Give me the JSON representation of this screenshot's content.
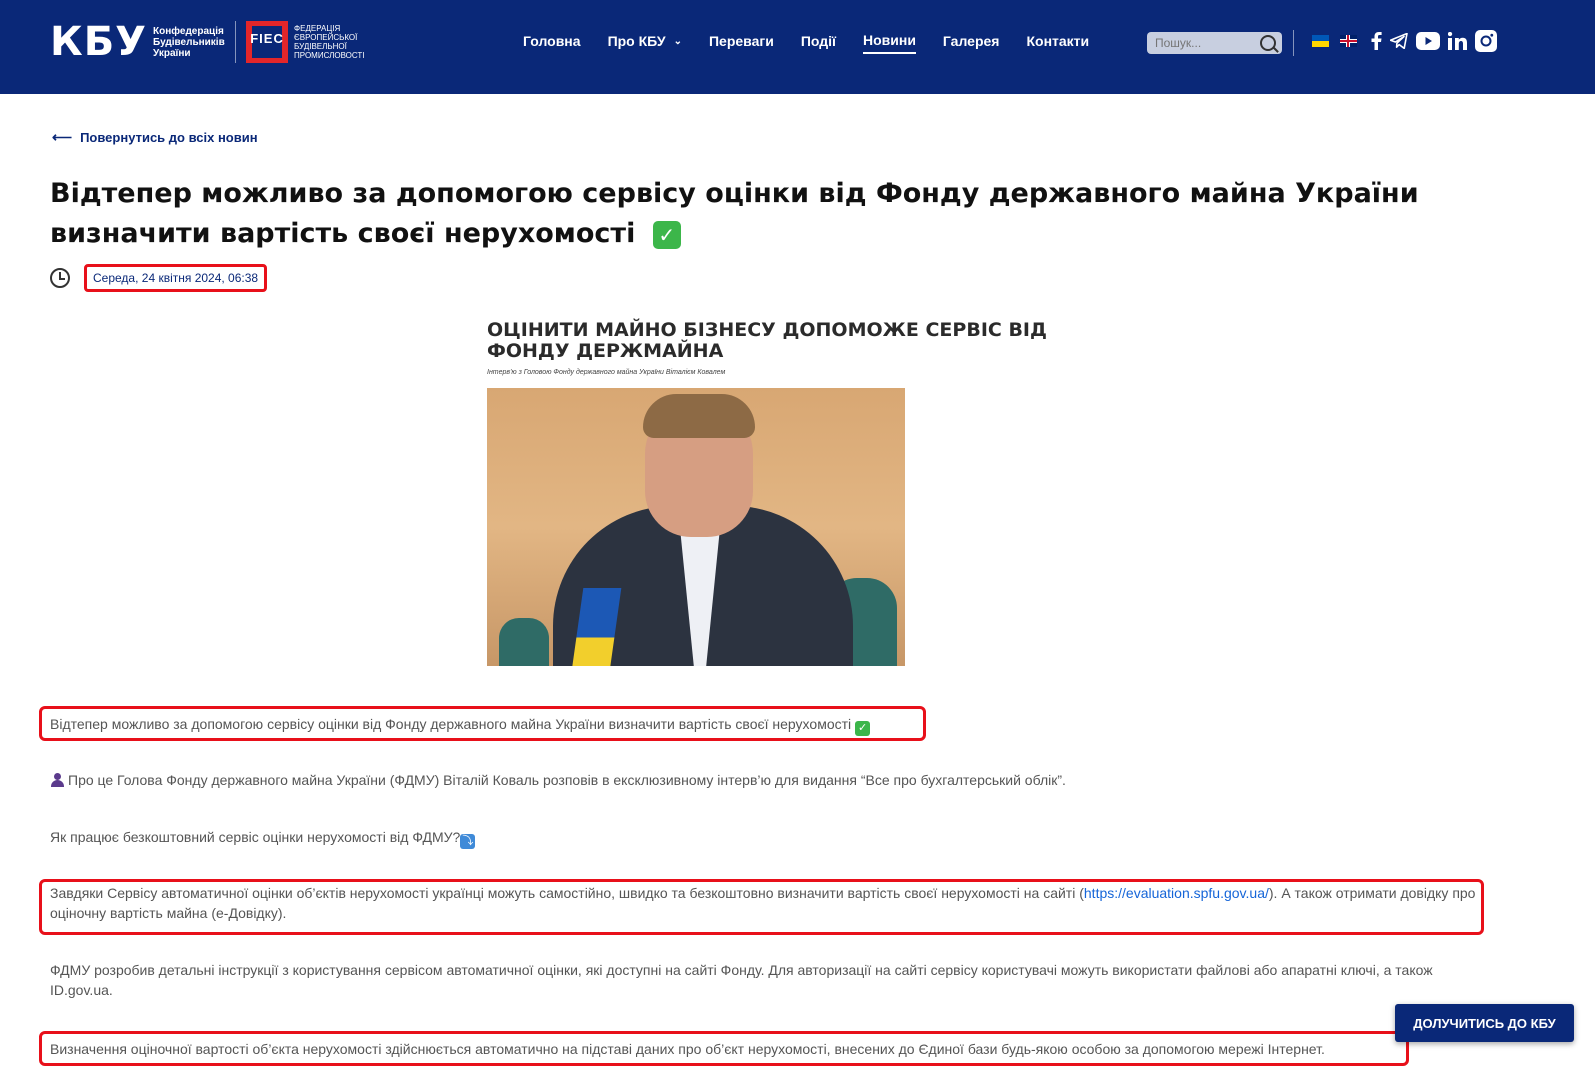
{
  "header": {
    "logo_text": "КБУ",
    "logo_sub": "Конфедерація Будівельників України",
    "fiec_text": "FIEC",
    "fiec_sub": "ФЕДЕРАЦІЯ ЄВРОПЕЙСЬКОЇ БУДІВЕЛЬНОЇ ПРОМИСЛОВОСТІ",
    "nav": [
      {
        "label": "Головна"
      },
      {
        "label": "Про КБУ"
      },
      {
        "label": "Переваги"
      },
      {
        "label": "Події"
      },
      {
        "label": "Новини"
      },
      {
        "label": "Галерея"
      },
      {
        "label": "Контакти"
      }
    ],
    "search_placeholder": "Пошук...",
    "social_icons": [
      "facebook-icon",
      "telegram-icon",
      "youtube-icon",
      "linkedin-icon",
      "instagram-icon"
    ]
  },
  "back_link": "Повернутись до всіх новин",
  "article": {
    "title": "Відтепер можливо за допомогою сервісу оцінки від Фонду державного майна України визначити вартість своєї нерухомості",
    "date": "Середа, 24 квітня 2024, 06:38",
    "image": {
      "headline": "ОЦІНИТИ МАЙНО БІЗНЕСУ ДОПОМОЖЕ СЕРВІС ВІД ФОНДУ ДЕРЖМАЙНА",
      "caption": "Інтерв'ю з Головою Фонду державного майна України Віталієм Ковалем"
    },
    "paragraphs": {
      "p1": "Відтепер можливо за допомогою сервісу оцінки від Фонду державного майна України визначити вартість своєї нерухомості",
      "p2": "Про це Голова Фонду державного майна України (ФДМУ) Віталій Коваль розповів в ексклюзивному інтерв’ю для видання “Все про бухгалтерський облік”.",
      "p3": "Як працює безкоштовний сервіс оцінки нерухомості від ФДМУ?",
      "p4_before": "Завдяки Сервісу автоматичної оцінки об’єктів нерухомості українці можуть самостійно, швидко та безкоштовно визначити вартість своєї нерухомості на сайті (",
      "p4_link": "https://evaluation.spfu.gov.ua/",
      "p4_after": "). А також отримати довідку про оціночну вартість майна (е-Довідку).",
      "p5": "ФДМУ розробив детальні інструкції з користування сервісом автоматичної оцінки, які доступні на сайті Фонду. Для авторизації на сайті сервісу користувачі можуть використати файлові або апаратні ключі, а також ID.gov.ua.",
      "p6": "Визначення оціночної вартості об’єкта нерухомості здійснюється автоматично на підставі даних про об’єкт нерухомості, внесених до Єдиної бази будь-якою особою за допомогою мережі Інтернет."
    }
  },
  "join_button": "ДОЛУЧИТИСЬ ДО КБУ",
  "colors": {
    "header_bg": "#0a2878",
    "highlight_red": "#e8101a",
    "link_blue": "#1565d8"
  }
}
